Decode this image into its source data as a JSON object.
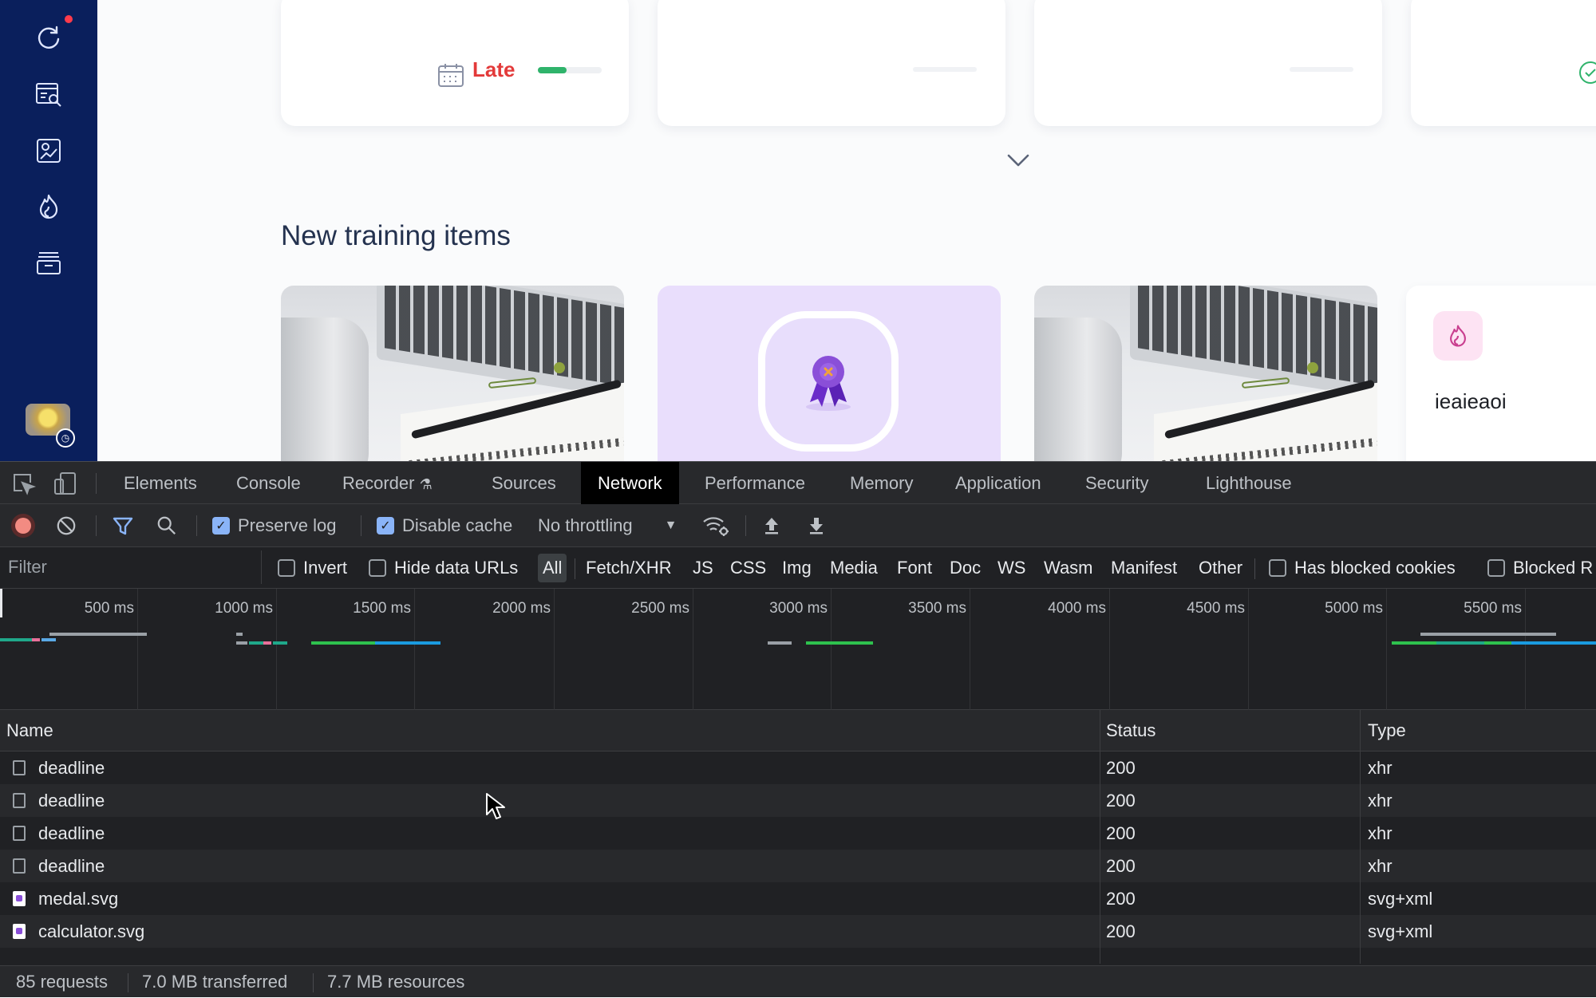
{
  "app": {
    "sidebar": {
      "items": [
        {
          "name": "refresh",
          "icon": "refresh-icon",
          "has_notification": true
        },
        {
          "name": "search-catalog",
          "icon": "catalog-search-icon"
        },
        {
          "name": "reports",
          "icon": "report-icon"
        },
        {
          "name": "training",
          "icon": "flame-icon"
        },
        {
          "name": "archive",
          "icon": "archive-icon"
        }
      ],
      "avatar_badge_icon": "clock-icon"
    },
    "deadline_cards": [
      {
        "status_label": "Late",
        "status_color": "#e33a3a",
        "progress_fraction": 0.45,
        "progress_color": "#2fb36b"
      },
      {
        "status_label": "",
        "progress_fraction": 0
      },
      {
        "status_label": "",
        "progress_fraction": 0
      }
    ],
    "section_title": "New training items",
    "training_items": [
      {
        "kind": "photo",
        "image": "laptop-notebook-photo"
      },
      {
        "kind": "icon",
        "image": "medal-icon",
        "background": "#e9defc"
      },
      {
        "kind": "photo",
        "image": "laptop-notebook-photo"
      },
      {
        "kind": "icon",
        "image": "flame-icon",
        "title": "ieaieaoi",
        "icon_background": "#fde3f3"
      }
    ]
  },
  "devtools": {
    "tabs": [
      "Elements",
      "Console",
      "Recorder",
      "Sources",
      "Network",
      "Performance",
      "Memory",
      "Application",
      "Security",
      "Lighthouse"
    ],
    "active_tab": "Network",
    "toolbar": {
      "preserve_log_label": "Preserve log",
      "preserve_log_checked": true,
      "disable_cache_label": "Disable cache",
      "disable_cache_checked": true,
      "throttling": "No throttling"
    },
    "filter": {
      "placeholder": "Filter",
      "invert_label": "Invert",
      "hide_data_urls_label": "Hide data URLs",
      "types": [
        "All",
        "Fetch/XHR",
        "JS",
        "CSS",
        "Img",
        "Media",
        "Font",
        "Doc",
        "WS",
        "Wasm",
        "Manifest",
        "Other"
      ],
      "active_type": "All",
      "has_blocked_cookies_label": "Has blocked cookies",
      "blocked_requests_label": "Blocked R"
    },
    "timeline": {
      "ticks": [
        "500 ms",
        "1000 ms",
        "1500 ms",
        "2000 ms",
        "2500 ms",
        "3000 ms",
        "3500 ms",
        "4000 ms",
        "4500 ms",
        "5000 ms",
        "5500 ms"
      ]
    },
    "table": {
      "columns": [
        "Name",
        "Status",
        "Type"
      ],
      "rows": [
        {
          "name": "deadline",
          "status": "200",
          "type": "xhr",
          "icon": "document-icon"
        },
        {
          "name": "deadline",
          "status": "200",
          "type": "xhr",
          "icon": "document-icon"
        },
        {
          "name": "deadline",
          "status": "200",
          "type": "xhr",
          "icon": "document-icon"
        },
        {
          "name": "deadline",
          "status": "200",
          "type": "xhr",
          "icon": "document-icon"
        },
        {
          "name": "medal.svg",
          "status": "200",
          "type": "svg+xml",
          "icon": "image-icon"
        },
        {
          "name": "calculator.svg",
          "status": "200",
          "type": "svg+xml",
          "icon": "image-icon"
        }
      ]
    },
    "status_bar": {
      "requests": "85 requests",
      "transferred": "7.0 MB transferred",
      "resources": "7.7 MB resources"
    }
  }
}
